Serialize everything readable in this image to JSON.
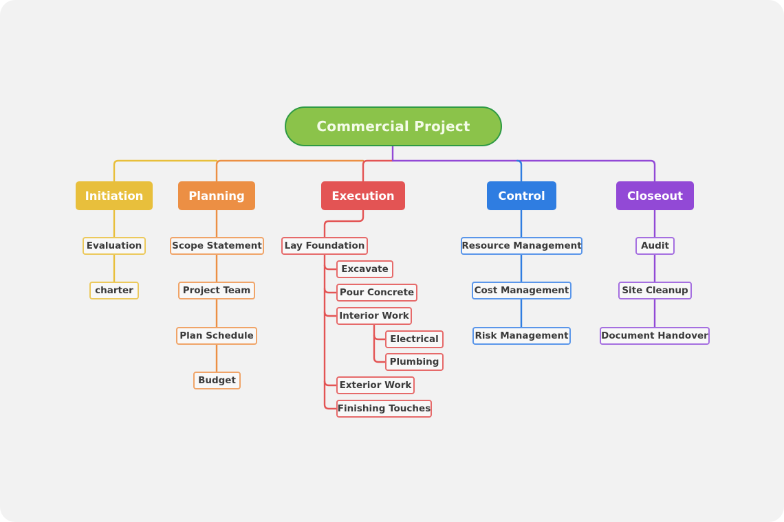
{
  "root": {
    "label": "Commercial Project",
    "fill": "#8bc34a",
    "border": "#2e9a44"
  },
  "branches": [
    {
      "label": "Initiation",
      "color": "#e8bf3c",
      "children": [
        {
          "label": "Evaluation"
        },
        {
          "label": "charter"
        }
      ]
    },
    {
      "label": "Planning",
      "color": "#ec8f44",
      "children": [
        {
          "label": "Scope Statement"
        },
        {
          "label": "Project Team"
        },
        {
          "label": "Plan Schedule"
        },
        {
          "label": "Budget"
        }
      ]
    },
    {
      "label": "Execution",
      "color": "#e35454",
      "children": [
        {
          "label": "Lay Foundation",
          "children": [
            {
              "label": "Excavate"
            },
            {
              "label": "Pour Concrete"
            },
            {
              "label": "Interior Work",
              "children": [
                {
                  "label": "Electrical"
                },
                {
                  "label": "Plumbing"
                }
              ]
            },
            {
              "label": "Exterior Work"
            },
            {
              "label": "Finishing Touches"
            }
          ]
        }
      ]
    },
    {
      "label": "Control",
      "color": "#2f7de1",
      "children": [
        {
          "label": "Resource Management"
        },
        {
          "label": "Cost Management"
        },
        {
          "label": "Risk Management"
        }
      ]
    },
    {
      "label": "Closeout",
      "color": "#9249d6",
      "children": [
        {
          "label": "Audit"
        },
        {
          "label": "Site Cleanup"
        },
        {
          "label": "Document Handover"
        }
      ]
    }
  ]
}
